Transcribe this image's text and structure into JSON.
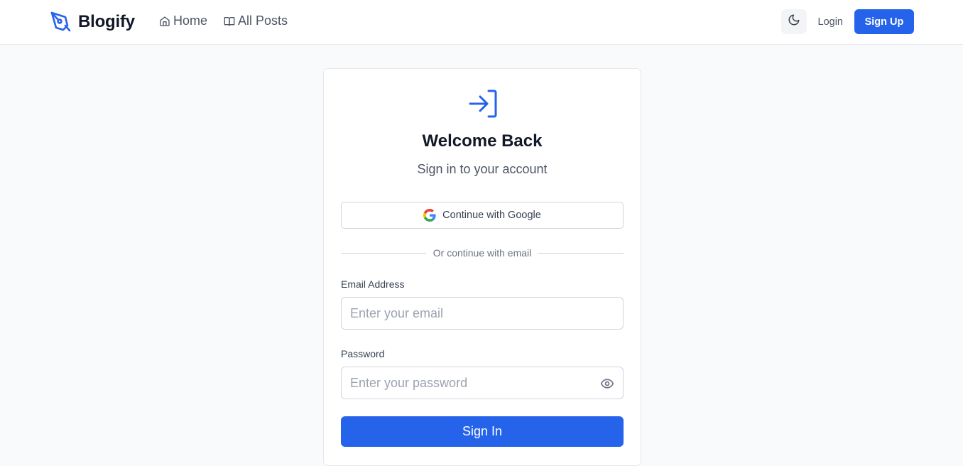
{
  "navbar": {
    "brand": "Blogify",
    "links": [
      {
        "label": "Home",
        "icon": "home-icon"
      },
      {
        "label": "All Posts",
        "icon": "book-open-icon"
      }
    ],
    "theme_toggle_icon": "moon-icon",
    "login_label": "Login",
    "signup_label": "Sign Up"
  },
  "login_card": {
    "icon": "log-in-icon",
    "title": "Welcome Back",
    "subtitle": "Sign in to your account",
    "google_button_label": "Continue with Google",
    "divider_text": "Or continue with email",
    "email": {
      "label": "Email Address",
      "placeholder": "Enter your email",
      "value": ""
    },
    "password": {
      "label": "Password",
      "placeholder": "Enter your password",
      "value": "",
      "toggle_icon": "eye-icon"
    },
    "submit_label": "Sign In"
  },
  "colors": {
    "accent": "#2563eb",
    "page_background": "#f9fafb",
    "text_primary": "#111827",
    "text_secondary": "#4b5563"
  }
}
